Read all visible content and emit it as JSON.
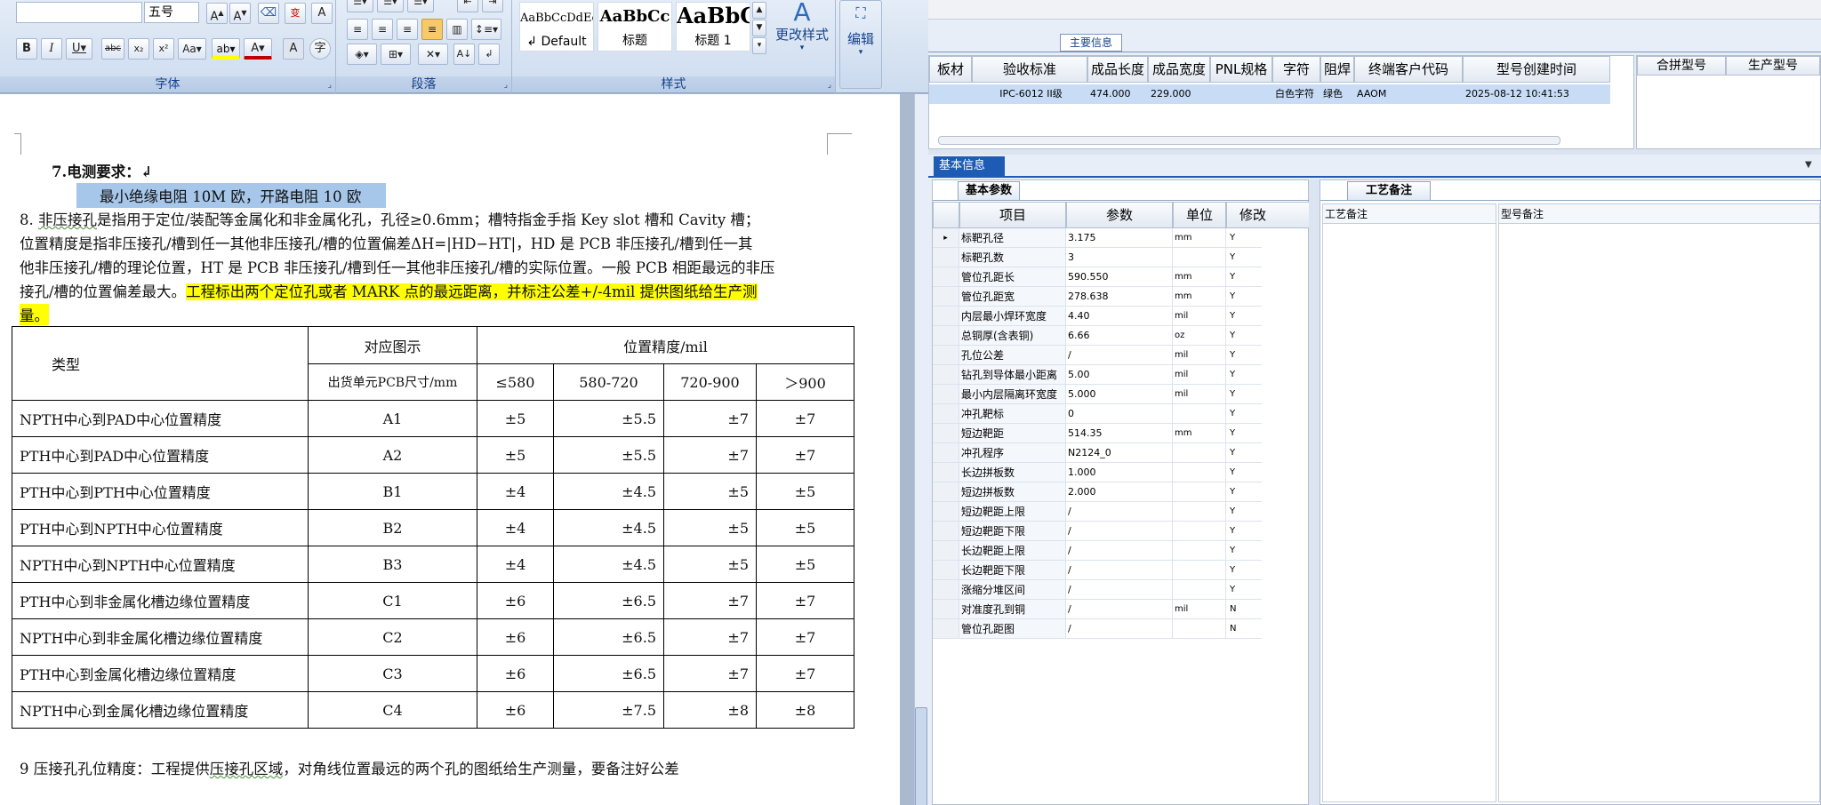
{
  "ribbon": {
    "font_size": "五号",
    "font_group": "字体",
    "para_group": "段落",
    "style_group": "样式",
    "styles": [
      {
        "preview": "AaBbCcDdEe",
        "name": "↲ Default"
      },
      {
        "preview": "AaBbCc",
        "name": "标题"
      },
      {
        "preview": "AaBbC",
        "name": "标题 1"
      }
    ],
    "change_style": "更改样式",
    "edit": "编辑"
  },
  "doc": {
    "section7": "7.电测要求：↲",
    "section7_detail": "最小绝缘电阻 10M 欧，开路电阻 10 欧",
    "p8_l1_a": "8.  ",
    "p8_l1_b": "非压接孔",
    "p8_l1_c": "是指用于定位/装配等金属化和非金属化孔，孔径≥0.6mm；槽特指金手指 Key slot 槽和 Cavity 槽；",
    "p8_l2": "位置精度是指非压接孔/槽到任一其他非压接孔/槽的位置偏差ΔH=|HD−HT|，HD 是 PCB 非压接孔/槽到任一其",
    "p8_l3": "他非压接孔/槽的理论位置，HT 是 PCB 非压接孔/槽到任一其他非压接孔/槽的实际位置。一般 PCB 相距最远的非压",
    "p8_l4_a": "接孔/槽的位置偏差最大。",
    "p8_l4_b": "工程标出两个定位孔或者 MARK 点的最远距离，并标注公差+/-4mil 提供图纸给生产测",
    "p8_l5": "量。",
    "table": {
      "head_type": "类型",
      "head_fig": "对应图示",
      "head_fig_sub": "出货单元PCB尺寸/mm",
      "head_prec": "位置精度/mil",
      "cols": [
        "≤580",
        "580-720",
        "720-900",
        "＞900"
      ],
      "rows": [
        {
          "type": "NPTH中心到PAD中心位置精度",
          "fig": "A1",
          "v": [
            "±5",
            "±5.5",
            "±7",
            "±7"
          ]
        },
        {
          "type": "PTH中心到PAD中心位置精度",
          "fig": "A2",
          "v": [
            "±5",
            "±5.5",
            "±7",
            "±7"
          ]
        },
        {
          "type": "PTH中心到PTH中心位置精度",
          "fig": "B1",
          "v": [
            "±4",
            "±4.5",
            "±5",
            "±5"
          ]
        },
        {
          "type": "PTH中心到NPTH中心位置精度",
          "fig": "B2",
          "v": [
            "±4",
            "±4.5",
            "±5",
            "±5"
          ]
        },
        {
          "type": "NPTH中心到NPTH中心位置精度",
          "fig": "B3",
          "v": [
            "±4",
            "±4.5",
            "±5",
            "±5"
          ]
        },
        {
          "type": "PTH中心到非金属化槽边缘位置精度",
          "fig": "C1",
          "v": [
            "±6",
            "±6.5",
            "±7",
            "±7"
          ]
        },
        {
          "type": "NPTH中心到非金属化槽边缘位置精度",
          "fig": "C2",
          "v": [
            "±6",
            "±6.5",
            "±7",
            "±7"
          ]
        },
        {
          "type": "PTH中心到金属化槽边缘位置精度",
          "fig": "C3",
          "v": [
            "±6",
            "±6.5",
            "±7",
            "±7"
          ]
        },
        {
          "type": "NPTH中心到金属化槽边缘位置精度",
          "fig": "C4",
          "v": [
            "±6",
            "±7.5",
            "±8",
            "±8"
          ]
        }
      ]
    },
    "p9_a": "9 压接孔孔位精度：工程提供",
    "p9_b": "压接孔区域",
    "p9_c": "，对角线位置最远的两个孔的图纸给生产测量，要备注好公差"
  },
  "right": {
    "main_info_tab": "主要信息",
    "top_headers": [
      "板材",
      "验收标准",
      "成品长度",
      "成品宽度",
      "PNL规格",
      "字符",
      "阻焊",
      "终端客户代码",
      "型号创建时间"
    ],
    "top_row": [
      "",
      "IPC-6012 II级",
      "474.000",
      "229.000",
      "",
      "白色字符",
      "绿色",
      "AAOM",
      "2025-08-12 10:41:53"
    ],
    "side_headers": [
      "合拼型号",
      "生产型号"
    ],
    "basic_info_tab": "基本信息",
    "basic_params_tab": "基本参数",
    "craft_notes_tab": "工艺备注",
    "param_headers": [
      "项目",
      "参数",
      "单位",
      "修改"
    ],
    "notes_headers": [
      "工艺备注",
      "型号备注"
    ],
    "params": [
      {
        "n": "标靶孔径",
        "v": "3.175",
        "u": "mm",
        "m": "Y"
      },
      {
        "n": "标靶孔数",
        "v": "3",
        "u": "",
        "m": "Y"
      },
      {
        "n": "管位孔距长",
        "v": "590.550",
        "u": "mm",
        "m": "Y"
      },
      {
        "n": "管位孔距宽",
        "v": "278.638",
        "u": "mm",
        "m": "Y"
      },
      {
        "n": "内层最小焊环宽度",
        "v": "4.40",
        "u": "mil",
        "m": "Y"
      },
      {
        "n": "总铜厚(含表铜)",
        "v": "6.66",
        "u": "oz",
        "m": "Y"
      },
      {
        "n": "孔位公差",
        "v": "/",
        "u": "mil",
        "m": "Y"
      },
      {
        "n": "钻孔到导体最小距离",
        "v": "5.00",
        "u": "mil",
        "m": "Y"
      },
      {
        "n": "最小内层隔离环宽度",
        "v": "5.000",
        "u": "mil",
        "m": "Y"
      },
      {
        "n": "冲孔靶标",
        "v": "0",
        "u": "",
        "m": "Y"
      },
      {
        "n": "短边靶距",
        "v": "514.35",
        "u": "mm",
        "m": "Y"
      },
      {
        "n": "冲孔程序",
        "v": "N2124_0",
        "u": "",
        "m": "Y"
      },
      {
        "n": "长边拼板数",
        "v": "1.000",
        "u": "",
        "m": "Y"
      },
      {
        "n": "短边拼板数",
        "v": "2.000",
        "u": "",
        "m": "Y"
      },
      {
        "n": "短边靶距上限",
        "v": "/",
        "u": "",
        "m": "Y"
      },
      {
        "n": "短边靶距下限",
        "v": "/",
        "u": "",
        "m": "Y"
      },
      {
        "n": "长边靶距上限",
        "v": "/",
        "u": "",
        "m": "Y"
      },
      {
        "n": "长边靶距下限",
        "v": "/",
        "u": "",
        "m": "Y"
      },
      {
        "n": "涨缩分堆区间",
        "v": "/",
        "u": "",
        "m": "Y"
      },
      {
        "n": "对准度孔到铜",
        "v": "/",
        "u": "mil",
        "m": "N"
      },
      {
        "n": "管位孔距图",
        "v": "/",
        "u": "",
        "m": "N"
      }
    ]
  }
}
